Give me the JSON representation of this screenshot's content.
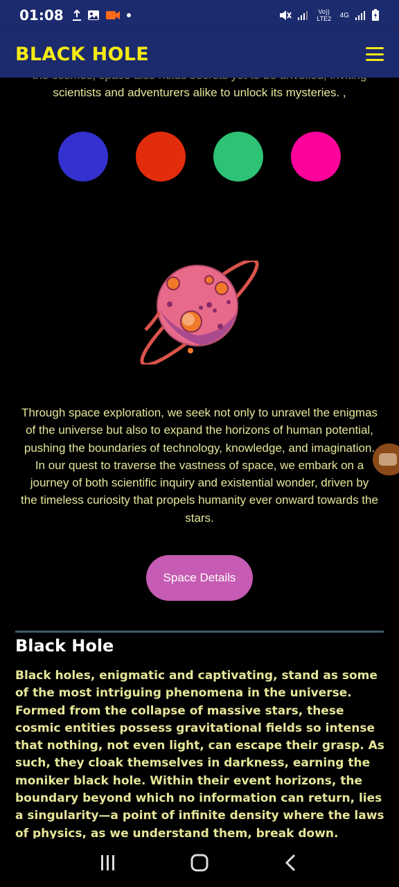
{
  "status": {
    "time": "01:08",
    "network_label": "Vo)) LTE2",
    "network_label_2": "4G"
  },
  "app_bar": {
    "title": "BLACK HOLE"
  },
  "intro": {
    "partial_line": "the cosmos, space also holds secrets yet to be unveiled, inviting",
    "line": "scientists and adventurers alike to unlock its mysteries. ,"
  },
  "colors": [
    {
      "name": "blue",
      "hex": "#3431cf"
    },
    {
      "name": "red",
      "hex": "#e22d0c"
    },
    {
      "name": "green",
      "hex": "#2dc275"
    },
    {
      "name": "pink",
      "hex": "#fc039c"
    }
  ],
  "body_text": "Through space exploration, we seek not only to unravel the enigmas of the universe but also to expand the horizons of human potential, pushing the boundaries of technology, knowledge, and imagination. In our quest to traverse the vastness of space, we embark on a journey of both scientific inquiry and existential wonder, driven by the timeless curiosity that propels humanity ever onward towards the stars.",
  "button": {
    "label": "Space Details"
  },
  "section": {
    "title": "Black Hole",
    "text": "Black holes, enigmatic and captivating, stand as some of the most intriguing phenomena in the universe. Formed from the collapse of massive stars, these cosmic entities possess gravitational fields so intense that nothing, not even light, can escape their grasp. As such, they cloak themselves in darkness, earning the moniker black hole. Within their event horizons, the boundary beyond which no information can return, lies a singularity—a point of infinite density where the laws of physics, as we understand them, break down."
  },
  "theme": {
    "app_bar_bg": "#1c2a6e",
    "title_color": "#f5ea14",
    "text_color": "#e6e69a",
    "button_bg": "#c55bb2"
  }
}
